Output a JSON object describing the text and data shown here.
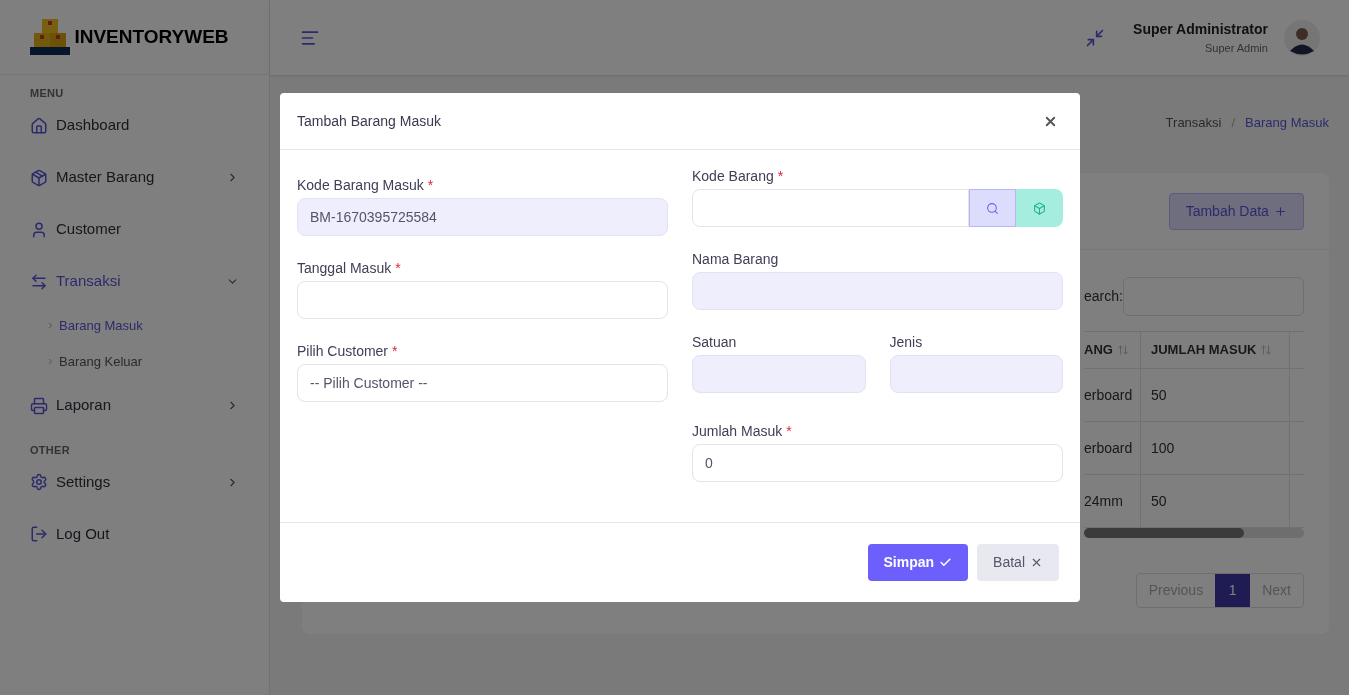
{
  "brand": {
    "name": "INVENTORYWEB"
  },
  "sidebar": {
    "sections": [
      {
        "heading": "MENU",
        "items": [
          {
            "label": "Dashboard",
            "kind": "home",
            "selected": false
          },
          {
            "label": "Master Barang",
            "kind": "box",
            "selected": false,
            "expanded": false
          },
          {
            "label": "Customer",
            "kind": "user",
            "selected": false
          },
          {
            "label": "Transaksi",
            "kind": "swap",
            "selected": true,
            "expanded": true,
            "children": [
              {
                "label": "Barang Masuk",
                "selected": true
              },
              {
                "label": "Barang Keluar",
                "selected": false
              }
            ]
          },
          {
            "label": "Laporan",
            "kind": "printer",
            "selected": false,
            "expanded": false
          }
        ]
      },
      {
        "heading": "OTHER",
        "items": [
          {
            "label": "Settings",
            "kind": "gear",
            "selected": false,
            "expanded": false
          },
          {
            "label": "Log Out",
            "kind": "logout",
            "selected": false
          }
        ]
      }
    ]
  },
  "header": {
    "user_name": "Super Administrator",
    "user_role": "Super Admin"
  },
  "breadcrumb": {
    "separator": "/",
    "items": [
      {
        "label": "Transaksi",
        "selected": false
      },
      {
        "label": "Barang Masuk",
        "selected": true
      }
    ]
  },
  "card": {
    "add_button": "Tambah Data",
    "search_label": "earch:",
    "table": {
      "columns": [
        "ANG",
        "JUMLAH MASUK"
      ],
      "rows": [
        [
          "erboard",
          "50"
        ],
        [
          "erboard",
          "100"
        ],
        [
          "24mm",
          "50"
        ]
      ]
    },
    "pagination": {
      "previous": "Previous",
      "pages": [
        {
          "label": "1",
          "selected": true
        }
      ],
      "next": "Next"
    }
  },
  "modal": {
    "title": "Tambah Barang Masuk",
    "left_fields": [
      {
        "label": "Kode Barang Masuk",
        "required_mark": "*",
        "readonly": true,
        "value": "BM-1670395725584"
      },
      {
        "label": "Tanggal Masuk",
        "required_mark": "*",
        "readonly": false
      },
      {
        "label": "Pilih Customer",
        "required_mark": "*",
        "readonly": false,
        "value": "-- Pilih Customer --"
      }
    ],
    "right_fields": [
      {
        "label": "Kode Barang",
        "required_mark": "*",
        "kind": "lookup",
        "readonly": false
      },
      {
        "label": "Nama Barang",
        "kind": "input",
        "readonly": true
      },
      {
        "label": "Satuan",
        "kind": "half",
        "readonly": true
      },
      {
        "label": "Jenis",
        "kind": "half",
        "readonly": true
      },
      {
        "label": "Jumlah Masuk",
        "required_mark": "*",
        "kind": "input",
        "readonly": false,
        "value": "0"
      }
    ],
    "buttons": [
      {
        "label": "Simpan",
        "kind": "primary"
      },
      {
        "label": "Batal",
        "kind": "secondary"
      }
    ]
  }
}
